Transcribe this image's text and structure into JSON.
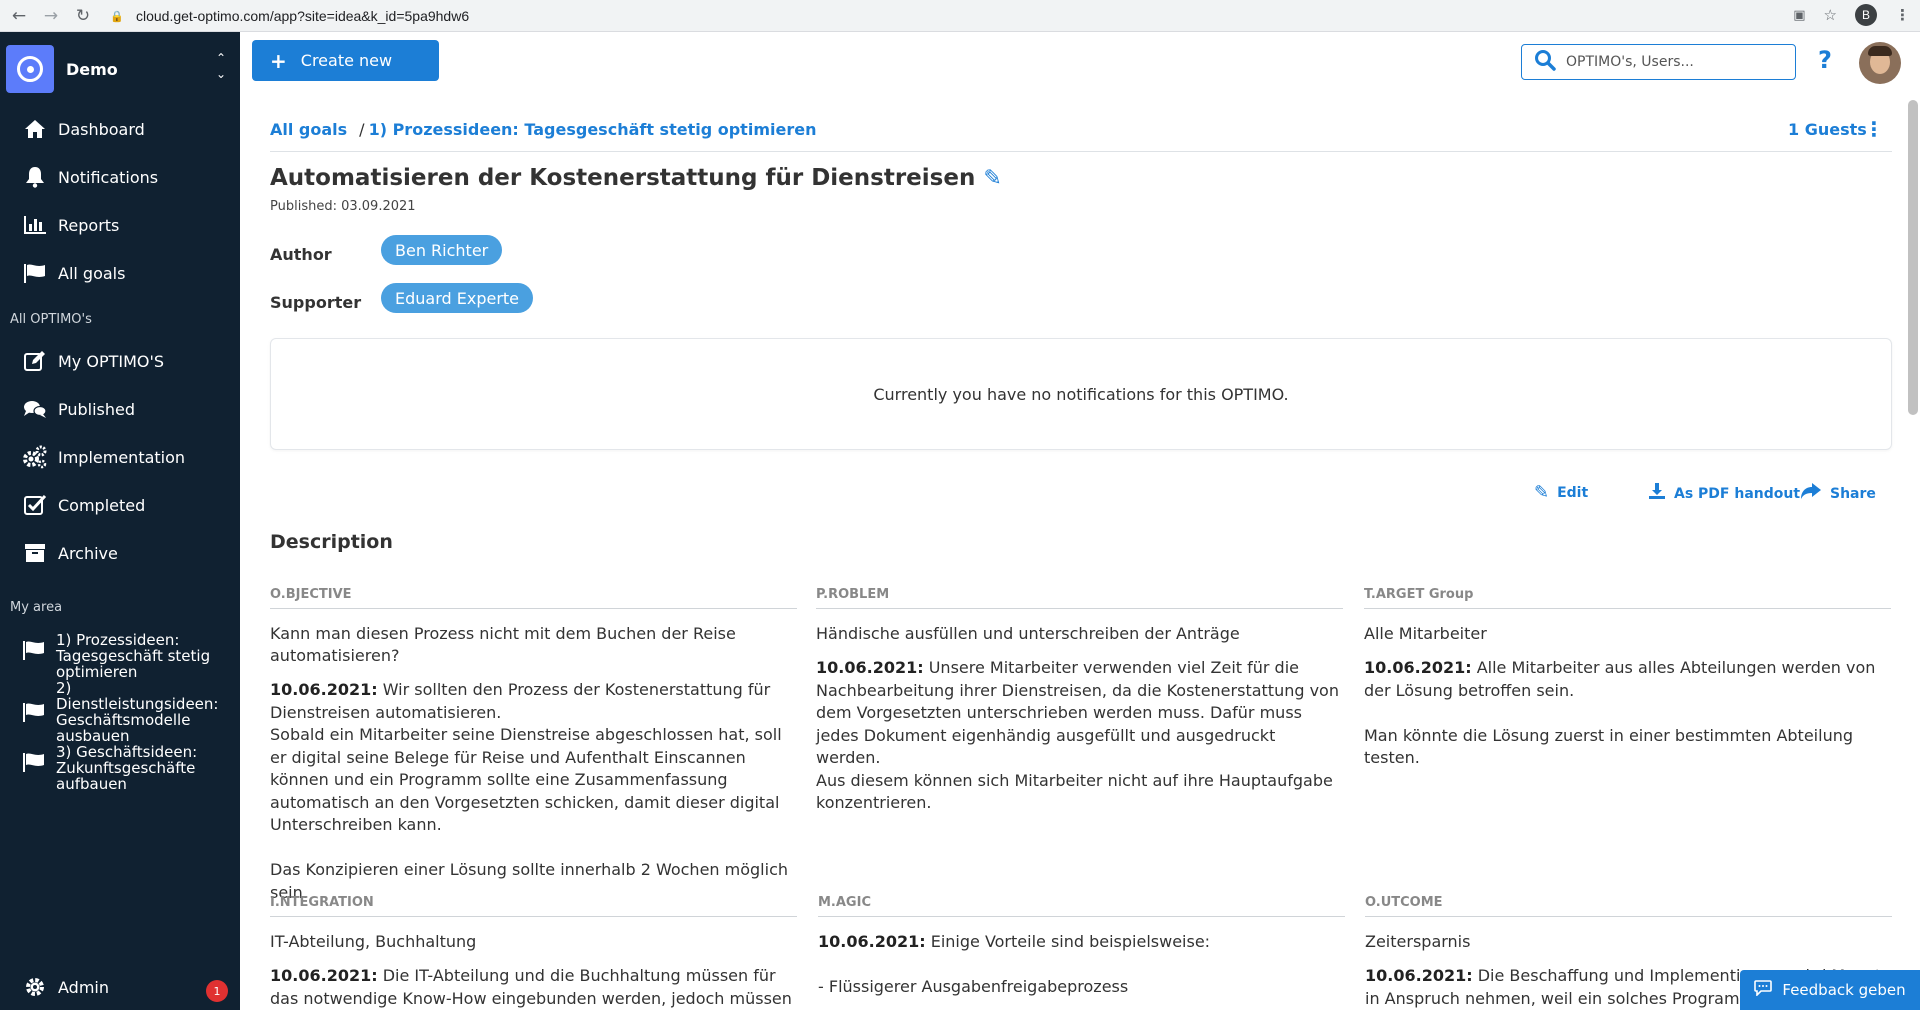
{
  "browser": {
    "url": "cloud.get-optimo.com/app?site=idea&k_id=5pa9hdw6",
    "profile_initial": "B"
  },
  "sidebar": {
    "org_name": "Demo",
    "main_items": [
      {
        "label": "Dashboard",
        "icon": "home-icon"
      },
      {
        "label": "Notifications",
        "icon": "bell-icon"
      },
      {
        "label": "Reports",
        "icon": "bar-chart-icon"
      },
      {
        "label": "All goals",
        "icon": "flag-icon"
      }
    ],
    "section_optimos": "All OPTIMO's",
    "optimo_items": [
      {
        "label": "My OPTIMO'S",
        "icon": "edit-icon"
      },
      {
        "label": "Published",
        "icon": "comments-icon"
      },
      {
        "label": "Implementation",
        "icon": "gears-icon"
      },
      {
        "label": "Completed",
        "icon": "check-square-icon"
      },
      {
        "label": "Archive",
        "icon": "archive-icon"
      }
    ],
    "section_my_area": "My area",
    "goal_items": [
      {
        "label": "1) Prozessideen: Tagesgeschäft stetig optimieren"
      },
      {
        "label": "2) Dienstleistungsideen: Geschäftsmodelle ausbauen"
      },
      {
        "label": "3) Geschäftsideen: Zukunftsgeschäfte aufbauen"
      }
    ],
    "admin_label": "Admin",
    "admin_badge": "1"
  },
  "header": {
    "create_label": "Create new",
    "search_placeholder": "OPTIMO's, Users...",
    "help": "?"
  },
  "content": {
    "breadcrumb_all": "All goals",
    "breadcrumb_sep": "/",
    "breadcrumb_current": "1) Prozessideen: Tagesgeschäft stetig optimieren",
    "guests": "1 Guests",
    "title": "Automatisieren der Kostenerstattung für Dienstreisen",
    "published": "Published: 03.09.2021",
    "author_label": "Author",
    "author": "Ben Richter",
    "supporter_label": "Supporter",
    "supporter": "Eduard Experte",
    "notifications_empty": "Currently you have no notifications for this OPTIMO.",
    "actions": {
      "edit": "Edit",
      "pdf": "As PDF handout",
      "share": "Share"
    },
    "description_heading": "Description",
    "columns": [
      {
        "head": "O.BJECTIVE",
        "lead": "Kann man diesen Prozess nicht mit dem Buchen der Reise automatisieren?",
        "date": "10.06.2021:",
        "body": " Wir sollten den Prozess der Kostenerstattung für Dienstreisen automatisieren.\nSobald ein Mitarbeiter seine Dienstreise abgeschlossen hat, soll er digital seine Belege für Reise und Aufenthalt Einscannen können und ein Programm sollte eine Zusammenfassung automatisch an den Vorgesetzten schicken, damit dieser digital Unterschreiben kann.\n\nDas Konzipieren einer Lösung sollte innerhalb 2 Wochen möglich sein."
      },
      {
        "head": "P.ROBLEM",
        "lead": "Händische ausfüllen und unterschreiben der Anträge",
        "date": "10.06.2021:",
        "body": " Unsere Mitarbeiter verwenden viel Zeit für die Nachbearbeitung ihrer Dienstreisen, da die Kostenerstattung von dem Vorgesetzten unterschrieben werden muss. Dafür muss jedes Dokument eigenhändig ausgefüllt und ausgedruckt werden.\nAus diesem können sich Mitarbeiter nicht auf ihre Hauptaufgabe konzentrieren."
      },
      {
        "head": "T.ARGET Group",
        "lead": "Alle Mitarbeiter",
        "date": "10.06.2021:",
        "body": " Alle Mitarbeiter aus alles Abteilungen werden von der Lösung betroffen sein.\n\nMan könnte die Lösung zuerst in einer bestimmten Abteilung testen."
      },
      {
        "head": "I.NTEGRATION",
        "lead": "IT-Abteilung, Buchhaltung",
        "date": "10.06.2021:",
        "body": " Die IT-Abteilung und die Buchhaltung müssen für das notwendige Know-How eingebunden werden, jedoch müssen wir alle"
      },
      {
        "head": "M.AGIC",
        "lead": "",
        "date": "10.06.2021:",
        "body": " Einige Vorteile sind beispielsweise:\n\n- Flüssigerer Ausgabenfreigabeprozess"
      },
      {
        "head": "O.UTCOME",
        "lead": "Zeitersparnis",
        "date": "10.06.2021:",
        "body": " Die Beschaffung und Implementierung wird Monate in Anspruch nehmen, weil ein solches Programm"
      }
    ],
    "feedback": "Feedback geben"
  }
}
